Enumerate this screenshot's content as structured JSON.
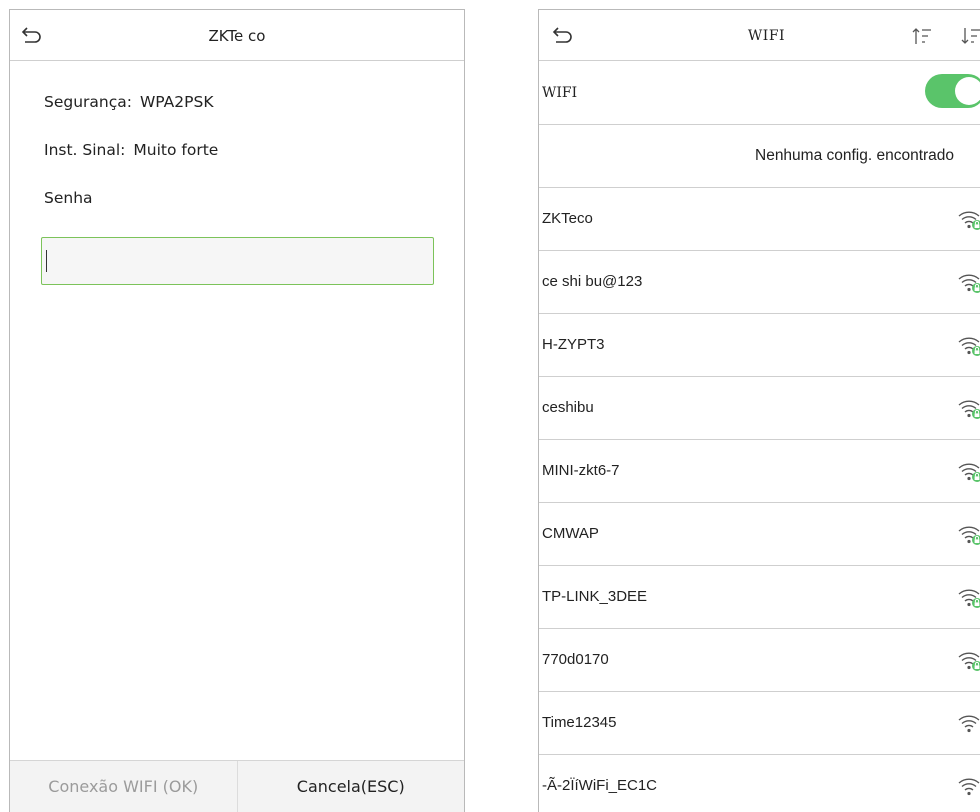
{
  "connect_dialog": {
    "title": "ZKTe co",
    "security_label": "Segurança:",
    "security_value": "WPA2PSK",
    "signal_label": "Inst. Sinal:",
    "signal_value": "Muito forte",
    "password_label": "Senha",
    "password_value": "",
    "ok_button": "Conexão WIFI (OK)",
    "cancel_button": "Cancela(ESC)"
  },
  "wifi_list": {
    "title": "WIFI",
    "toggle_label": "WIFI",
    "toggle_on": true,
    "empty_message": "Nenhuma config. encontrado",
    "networks": [
      {
        "ssid": "ZKTeco",
        "icon": "wifi-secured-icon"
      },
      {
        "ssid": "ce shi bu@123",
        "icon": "wifi-secured-icon"
      },
      {
        "ssid": "H-ZYPT3",
        "icon": "wifi-secured-icon"
      },
      {
        "ssid": "ceshibu",
        "icon": "wifi-secured-icon"
      },
      {
        "ssid": "MINI-zkt6-7",
        "icon": "wifi-secured-icon"
      },
      {
        "ssid": "CMWAP",
        "icon": "wifi-secured-icon"
      },
      {
        "ssid": "TP-LINK_3DEE",
        "icon": "wifi-secured-icon"
      },
      {
        "ssid": "770d0170",
        "icon": "wifi-secured-icon"
      },
      {
        "ssid": "Time12345",
        "icon": "wifi-open-icon"
      },
      {
        "ssid": "-Ã-2ÏíWiFi_EC1C",
        "icon": "wifi-open-icon"
      }
    ]
  },
  "colors": {
    "accent_green": "#5ac46a",
    "input_border": "#7cc35a",
    "divider": "#cfcfcf"
  }
}
